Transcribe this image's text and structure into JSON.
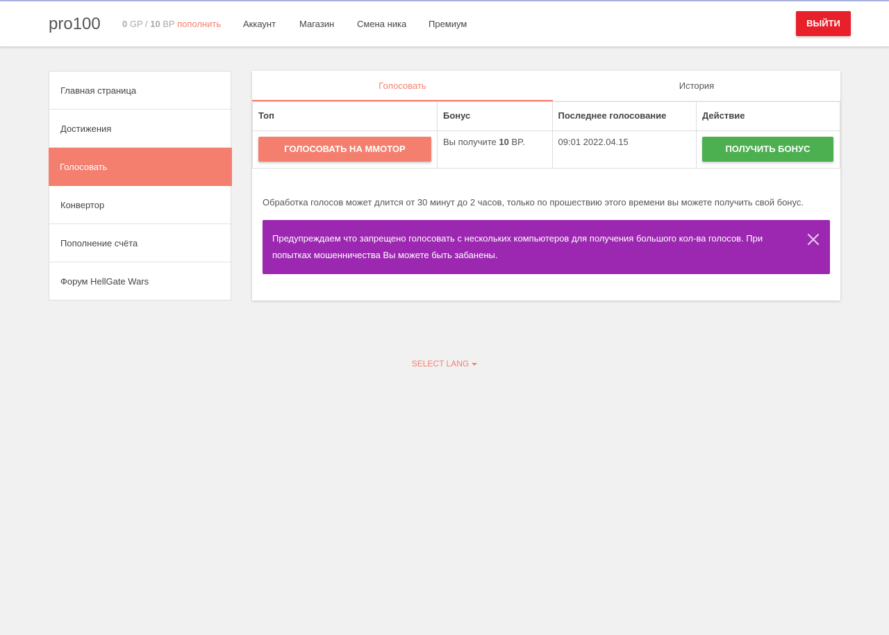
{
  "header": {
    "brand": "pro100",
    "gp_value": "0",
    "gp_unit": "GP /",
    "bp_value": "10",
    "bp_unit": "BP",
    "topup_label": "пополнить",
    "nav": [
      "Аккаунт",
      "Магазин",
      "Смена ника",
      "Премиум"
    ],
    "logout_label": "ВЫЙТИ"
  },
  "sidebar": {
    "items": [
      {
        "label": "Главная страница"
      },
      {
        "label": "Достижения"
      },
      {
        "label": "Голосовать",
        "active": true
      },
      {
        "label": "Конвертор"
      },
      {
        "label": "Пополнение счёта"
      },
      {
        "label": "Форум HellGate Wars"
      }
    ]
  },
  "tabs": [
    {
      "label": "Голосовать",
      "active": true
    },
    {
      "label": "История"
    }
  ],
  "table": {
    "headers": [
      "Топ",
      "Бонус",
      "Последнее голосование",
      "Действие"
    ],
    "row": {
      "vote_button": "ГОЛОСОВАТЬ НА MMOTOP",
      "bonus_prefix": "Вы получите",
      "bonus_amount": "10",
      "bonus_suffix": "BP.",
      "last_vote": "09:01 2022.04.15",
      "bonus_button": "ПОЛУЧИТЬ БОНУС"
    }
  },
  "info_text": "Обработка голосов может длится от 30 минут до 2 часов, только по прошествию этого времени вы можете получить свой бонус.",
  "alert": {
    "text": "Предупреждаем что запрещено голосовать с нескольких компьютеров для получения большого кол-ва голосов. При попытках мошенничества Вы можете быть забанены.",
    "close_icon": "close-icon"
  },
  "footer": {
    "lang_label": "SELECT LANG"
  },
  "colors": {
    "accent": "#f47f6f",
    "logout": "#e8202a",
    "success": "#4caf50",
    "alert": "#9c27b0"
  }
}
